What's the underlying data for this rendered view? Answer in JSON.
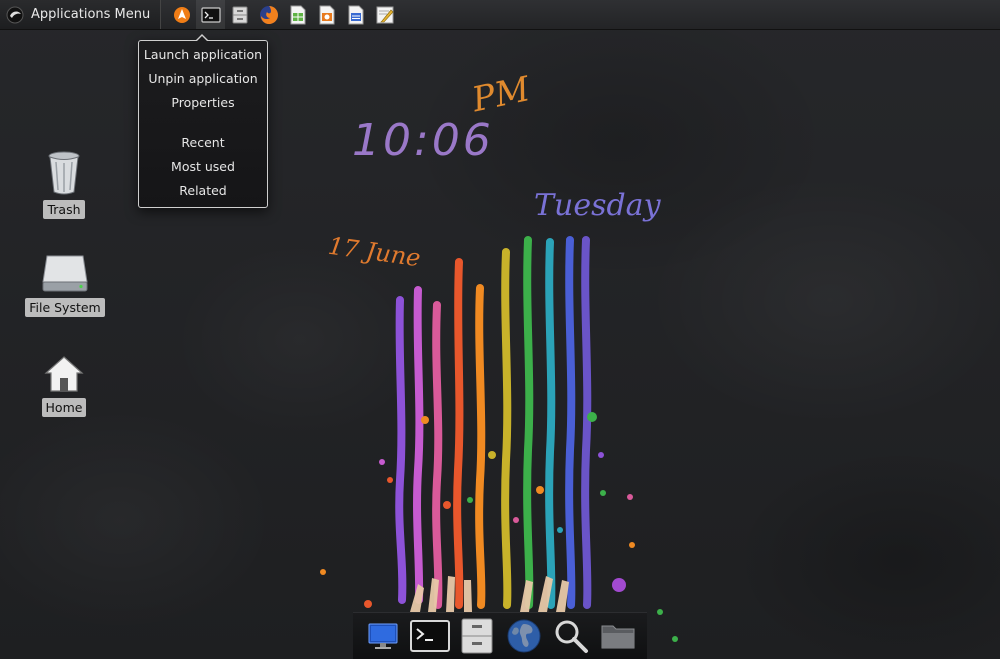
{
  "panel": {
    "apps_menu_label": "Applications Menu",
    "launchers": [
      {
        "icon": "app-finder-icon"
      },
      {
        "icon": "terminal-icon"
      },
      {
        "icon": "file-cabinet-icon"
      },
      {
        "icon": "firefox-icon"
      },
      {
        "icon": "spreadsheet-icon"
      },
      {
        "icon": "presentation-icon"
      },
      {
        "icon": "document-icon"
      },
      {
        "icon": "text-editor-icon"
      }
    ]
  },
  "context_menu": {
    "items": [
      "Launch application",
      "Unpin application",
      "Properties",
      "Recent",
      "Most used",
      "Related"
    ]
  },
  "desktop_icons": [
    {
      "label": "Trash",
      "icon": "trash-icon"
    },
    {
      "label": "File System",
      "icon": "drive-icon"
    },
    {
      "label": "Home",
      "icon": "home-icon"
    }
  ],
  "dock": {
    "items": [
      {
        "icon": "display-icon"
      },
      {
        "icon": "terminal-icon"
      },
      {
        "icon": "file-cabinet-icon"
      },
      {
        "icon": "globe-icon"
      },
      {
        "icon": "search-icon"
      },
      {
        "icon": "folder-icon"
      }
    ]
  },
  "wallpaper": {
    "time": "10:06",
    "meridiem": "PM",
    "date": "17 June",
    "weekday": "Tuesday"
  },
  "colors": {
    "panel_bg": "#2a2b2e",
    "menu_border": "#cfcfcf",
    "label_bg": "#d2d2d2"
  }
}
